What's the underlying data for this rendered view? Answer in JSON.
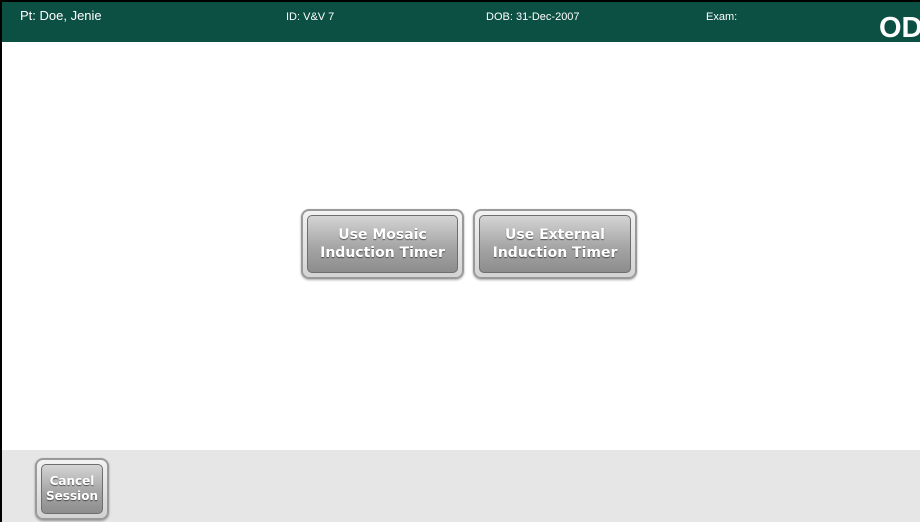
{
  "header": {
    "patient": "Pt:  Doe, Jenie",
    "id": "ID: V&V 7",
    "dob": "DOB:  31-Dec-2007",
    "exam": "Exam:",
    "eye": "OD"
  },
  "main": {
    "mosaic_button": {
      "line1": "Use Mosaic",
      "line2": "Induction Timer"
    },
    "external_button": {
      "line1": "Use External",
      "line2": "Induction Timer"
    }
  },
  "footer": {
    "cancel_button": {
      "line1": "Cancel",
      "line2": "Session"
    }
  },
  "colors": {
    "header_bg": "#0c4f43",
    "footer_bg": "#e6e6e6",
    "button_gray": "#a6a6a6"
  }
}
